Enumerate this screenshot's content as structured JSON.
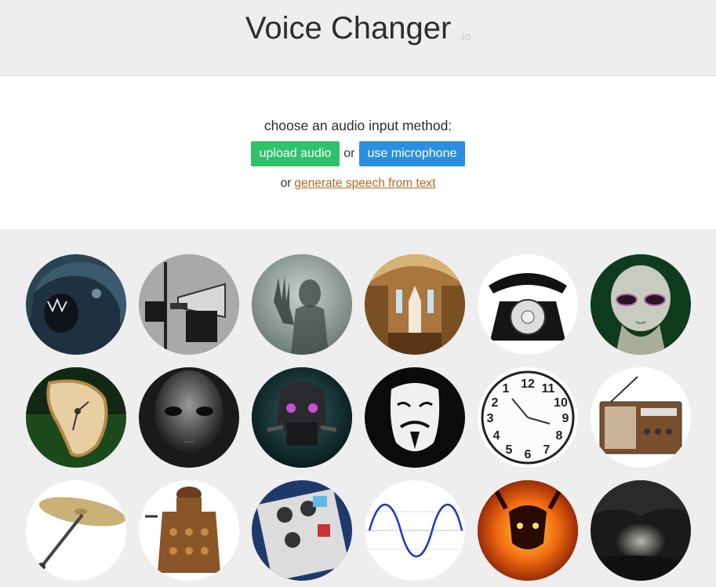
{
  "header": {
    "title": "Voice Changer",
    "suffix": ".io"
  },
  "input": {
    "prompt": "choose an audio input method:",
    "upload_label": "upload audio",
    "or_label": "or",
    "mic_label": "use microphone",
    "or_label2": "or",
    "text_link": "generate speech from text"
  },
  "voices": [
    {
      "icon": "monster-icon"
    },
    {
      "icon": "megaphone-icon"
    },
    {
      "icon": "ghost-icon"
    },
    {
      "icon": "cathedral-icon"
    },
    {
      "icon": "telephone-icon"
    },
    {
      "icon": "alien-icon"
    },
    {
      "icon": "melting-clock-icon"
    },
    {
      "icon": "grey-alien-icon"
    },
    {
      "icon": "robot-icon"
    },
    {
      "icon": "anonymous-mask-icon"
    },
    {
      "icon": "reversed-clock-icon"
    },
    {
      "icon": "radio-icon"
    },
    {
      "icon": "cymbal-icon"
    },
    {
      "icon": "dalek-icon"
    },
    {
      "icon": "guitar-pedal-icon"
    },
    {
      "icon": "sine-wave-icon"
    },
    {
      "icon": "balrog-icon"
    },
    {
      "icon": "cave-icon"
    }
  ],
  "colors": {
    "green": "#2ec26a",
    "blue": "#2a8fe0",
    "link": "#b7671f"
  }
}
